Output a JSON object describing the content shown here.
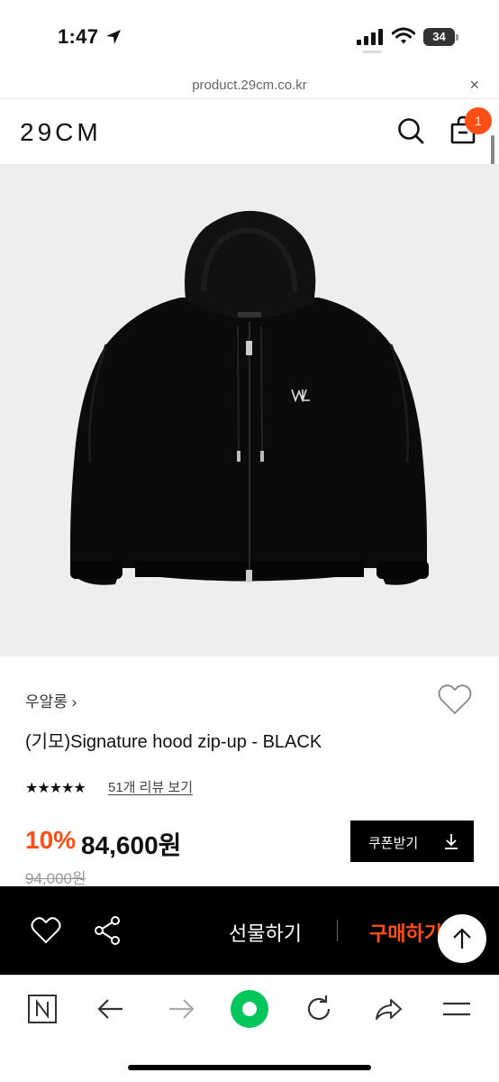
{
  "status_bar": {
    "time": "1:47",
    "battery": "34"
  },
  "url_bar": {
    "url": "product.29cm.co.kr",
    "close": "×"
  },
  "header": {
    "logo": "29CM",
    "cart_count": "1"
  },
  "product": {
    "brand": "우알롱 ›",
    "title": "(기모)Signature hood zip-up - BLACK",
    "rating_stars": "★★★★★",
    "review_link": "51개 리뷰 보기",
    "discount": "10%",
    "price": "84,600원",
    "original_price": "94,000원",
    "coupon_label": "쿠폰받기"
  },
  "action_bar": {
    "gift_label": "선물하기",
    "buy_label": "구매하기"
  },
  "colors": {
    "accent": "#ff4e16",
    "dark": "#000000",
    "image_bg": "#eeeeee",
    "naver_green": "#03c75a"
  },
  "icons": [
    "location-arrow-icon",
    "signal-icon",
    "wifi-icon",
    "battery-icon",
    "search-icon",
    "cart-icon",
    "heart-icon",
    "download-icon",
    "share-icon",
    "arrow-up-icon",
    "naver-n-icon",
    "back-arrow-icon",
    "forward-arrow-icon",
    "naver-green-button-icon",
    "refresh-icon",
    "share-arrow-icon",
    "menu-icon"
  ]
}
